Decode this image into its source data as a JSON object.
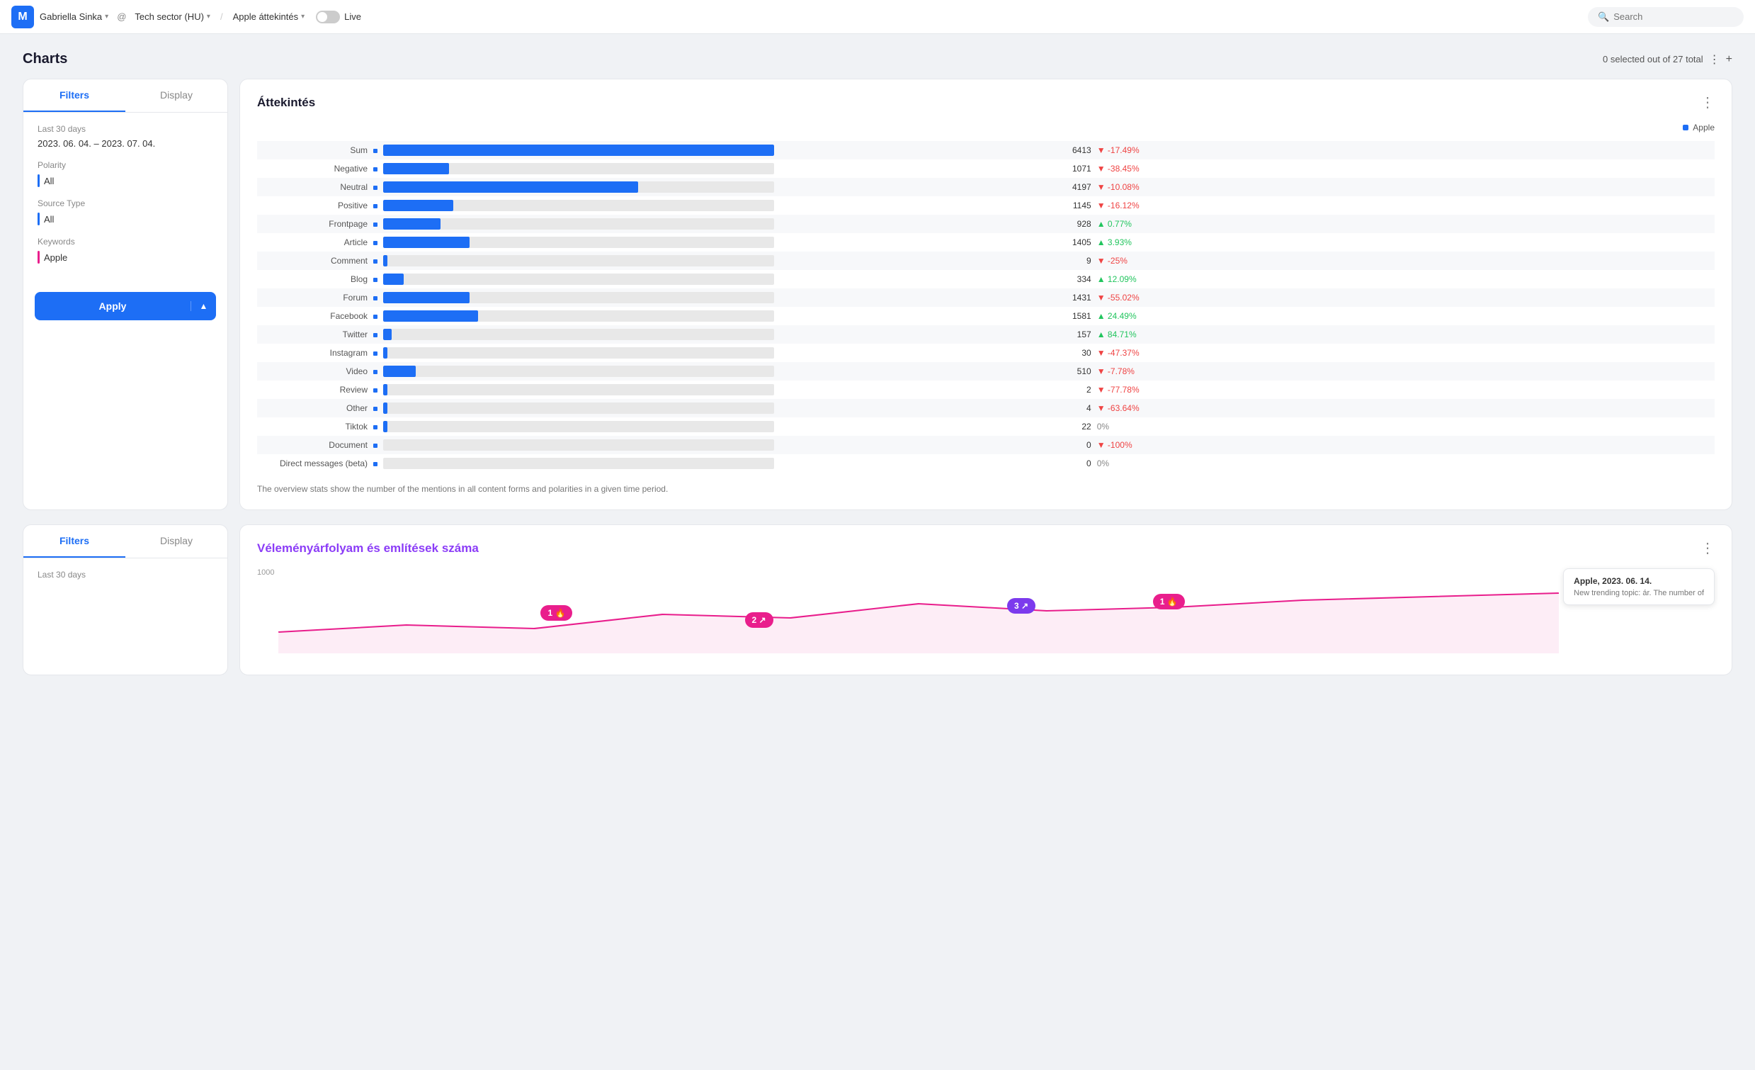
{
  "app": {
    "logo_letter": "M",
    "user": "Gabriella Sinka",
    "at_symbol": "@",
    "workspace": "Tech sector (HU)",
    "slash": "/",
    "view": "Apple áttekintés",
    "live_label": "Live",
    "search_placeholder": "Search"
  },
  "charts_header": {
    "title": "Charts",
    "selection_info": "0 selected out of 27 total",
    "menu_icon": "⋮",
    "add_icon": "+"
  },
  "filters_panel": {
    "tab_filters": "Filters",
    "tab_display": "Display",
    "date_label": "Last 30 days",
    "date_range": "2023. 06. 04. – 2023. 07. 04.",
    "polarity_label": "Polarity",
    "polarity_value": "All",
    "polarity_color": "#1d6ef5",
    "source_type_label": "Source Type",
    "source_type_value": "All",
    "source_type_color": "#1d6ef5",
    "keywords_label": "Keywords",
    "keywords_value": "Apple",
    "keywords_color": "#e91e8c",
    "apply_label": "Apply",
    "apply_chevron": "▲"
  },
  "overview_chart": {
    "title": "Áttekintés",
    "menu_icon": "⋮",
    "legend_label": "Apple",
    "legend_color": "#1d6ef5",
    "description": "The overview stats show the number of the mentions in all content forms and polarities in a given time period.",
    "rows": [
      {
        "label": "Sum",
        "value": "6413",
        "pct": "-17.49%",
        "dir": "down",
        "bar_pct": 95
      },
      {
        "label": "Negative",
        "value": "1071",
        "pct": "-38.45%",
        "dir": "down",
        "bar_pct": 16
      },
      {
        "label": "Neutral",
        "value": "4197",
        "pct": "-10.08%",
        "dir": "down",
        "bar_pct": 62
      },
      {
        "label": "Positive",
        "value": "1145",
        "pct": "-16.12%",
        "dir": "down",
        "bar_pct": 17
      },
      {
        "label": "Frontpage",
        "value": "928",
        "pct": "0.77%",
        "dir": "up",
        "bar_pct": 14
      },
      {
        "label": "Article",
        "value": "1405",
        "pct": "3.93%",
        "dir": "up",
        "bar_pct": 21
      },
      {
        "label": "Comment",
        "value": "9",
        "pct": "-25%",
        "dir": "down",
        "bar_pct": 1
      },
      {
        "label": "Blog",
        "value": "334",
        "pct": "12.09%",
        "dir": "up",
        "bar_pct": 5
      },
      {
        "label": "Forum",
        "value": "1431",
        "pct": "-55.02%",
        "dir": "down",
        "bar_pct": 21
      },
      {
        "label": "Facebook",
        "value": "1581",
        "pct": "24.49%",
        "dir": "up",
        "bar_pct": 23
      },
      {
        "label": "Twitter",
        "value": "157",
        "pct": "84.71%",
        "dir": "up",
        "bar_pct": 2
      },
      {
        "label": "Instagram",
        "value": "30",
        "pct": "-47.37%",
        "dir": "down",
        "bar_pct": 1
      },
      {
        "label": "Video",
        "value": "510",
        "pct": "-7.78%",
        "dir": "down",
        "bar_pct": 8
      },
      {
        "label": "Review",
        "value": "2",
        "pct": "-77.78%",
        "dir": "down",
        "bar_pct": 1
      },
      {
        "label": "Other",
        "value": "4",
        "pct": "-63.64%",
        "dir": "down",
        "bar_pct": 1
      },
      {
        "label": "Tiktok",
        "value": "22",
        "pct": "0%",
        "dir": "zero",
        "bar_pct": 1
      },
      {
        "label": "Document",
        "value": "0",
        "pct": "-100%",
        "dir": "down",
        "bar_pct": 0
      },
      {
        "label": "Direct messages (beta)",
        "value": "0",
        "pct": "0%",
        "dir": "zero",
        "bar_pct": 0
      }
    ]
  },
  "second_panel": {
    "filters_tab": "Filters",
    "display_tab": "Display",
    "date_label": "Last 30 days",
    "chart_title": "Véleményárfolyam és említések száma",
    "chart_menu": "⋮",
    "y_label": "1000",
    "tooltip": {
      "brand": "Apple, 2023. 06. 14.",
      "sub": "New trending topic: ár. The number of"
    },
    "bubbles": [
      {
        "id": 1,
        "icon": "🔥",
        "color": "pink",
        "x_pct": 22
      },
      {
        "id": 2,
        "icon": "↗",
        "color": "pink",
        "x_pct": 38
      },
      {
        "id": 3,
        "icon": "↗",
        "color": "purple",
        "x_pct": 58
      },
      {
        "id": 1,
        "icon": "🔥",
        "color": "pink",
        "x_pct": 68
      }
    ]
  }
}
